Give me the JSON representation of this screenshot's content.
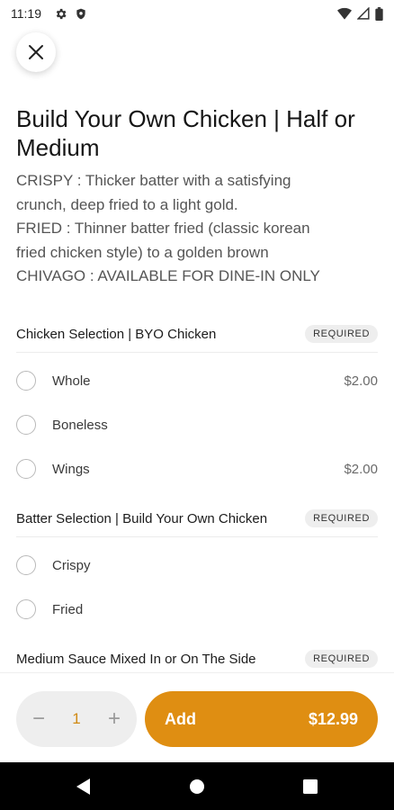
{
  "status_bar": {
    "time": "11:19",
    "left_icons": [
      "gear-icon",
      "shield-icon"
    ],
    "right_icons": [
      "wifi-icon",
      "signal-icon",
      "battery-icon"
    ]
  },
  "header": {
    "close_icon": "close-icon"
  },
  "item": {
    "title": "Build Your Own Chicken | Half or Medium",
    "description_lines": [
      "CRISPY : Thicker batter with a satisfying",
      "crunch, deep fried to a light gold.",
      "FRIED : Thinner batter fried (classic korean",
      "fried chicken style) to a golden brown",
      "CHIVAGO : AVAILABLE FOR DINE-IN ONLY"
    ]
  },
  "sections": [
    {
      "title": "Chicken Selection | BYO Chicken",
      "badge": "REQUIRED",
      "options": [
        {
          "label": "Whole",
          "price": "$2.00"
        },
        {
          "label": "Boneless",
          "price": ""
        },
        {
          "label": "Wings",
          "price": "$2.00"
        }
      ]
    },
    {
      "title": "Batter Selection | Build Your Own Chicken",
      "badge": "REQUIRED",
      "options": [
        {
          "label": "Crispy",
          "price": ""
        },
        {
          "label": "Fried",
          "price": ""
        }
      ]
    },
    {
      "title": "Medium Sauce Mixed In or On The Side",
      "badge": "REQUIRED",
      "options": []
    }
  ],
  "footer": {
    "decrement": "−",
    "quantity": "1",
    "increment": "+",
    "add_label": "Add",
    "add_price": "$12.99",
    "accent_color": "#df8e12"
  },
  "nav": {
    "icons": [
      "back-icon",
      "home-icon",
      "recents-icon"
    ]
  }
}
